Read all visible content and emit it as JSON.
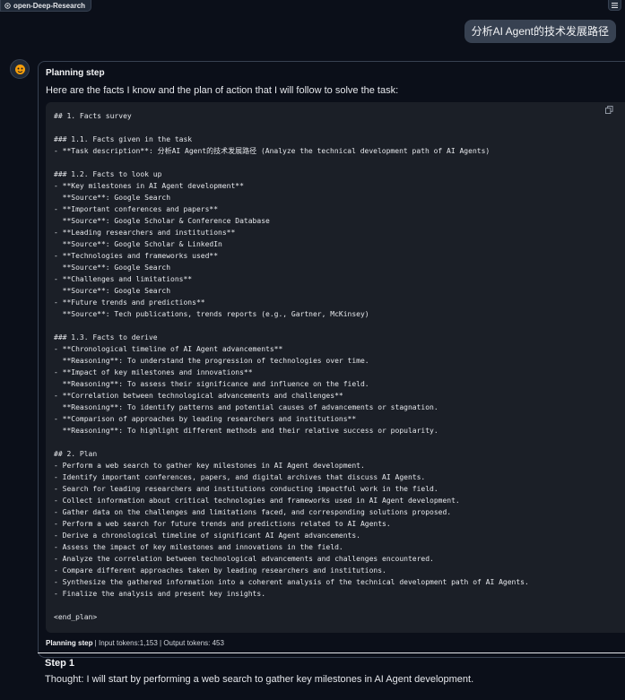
{
  "app": {
    "tab_title": "open-Deep-Research"
  },
  "user_message": {
    "text": "分析AI Agent的技术发展路径"
  },
  "planning": {
    "title": "Planning step",
    "intro": "Here are the facts I know and the plan of action that I will follow to solve the task:",
    "code_lines": [
      "## 1. Facts survey",
      "",
      "### 1.1. Facts given in the task",
      "- **Task description**: 分析AI Agent的技术发展路径 (Analyze the technical development path of AI Agents)",
      "",
      "### 1.2. Facts to look up",
      "- **Key milestones in AI Agent development**",
      "  **Source**: Google Search",
      "- **Important conferences and papers**",
      "  **Source**: Google Scholar & Conference Database",
      "- **Leading researchers and institutions**",
      "  **Source**: Google Scholar & LinkedIn",
      "- **Technologies and frameworks used**",
      "  **Source**: Google Search",
      "- **Challenges and limitations**",
      "  **Source**: Google Search",
      "- **Future trends and predictions**",
      "  **Source**: Tech publications, trends reports (e.g., Gartner, McKinsey)",
      "",
      "### 1.3. Facts to derive",
      "- **Chronological timeline of AI Agent advancements**",
      "  **Reasoning**: To understand the progression of technologies over time.",
      "- **Impact of key milestones and innovations**",
      "  **Reasoning**: To assess their significance and influence on the field.",
      "- **Correlation between technological advancements and challenges**",
      "  **Reasoning**: To identify patterns and potential causes of advancements or stagnation.",
      "- **Comparison of approaches by leading researchers and institutions**",
      "  **Reasoning**: To highlight different methods and their relative success or popularity.",
      "",
      "## 2. Plan",
      "- Perform a web search to gather key milestones in AI Agent development.",
      "- Identify important conferences, papers, and digital archives that discuss AI Agents.",
      "- Search for leading researchers and institutions conducting impactful work in the field.",
      "- Collect information about critical technologies and frameworks used in AI Agent development.",
      "- Gather data on the challenges and limitations faced, and corresponding solutions proposed.",
      "- Perform a web search for future trends and predictions related to AI Agents.",
      "- Derive a chronological timeline of significant AI Agent advancements.",
      "- Assess the impact of key milestones and innovations in the field.",
      "- Analyze the correlation between technological advancements and challenges encountered.",
      "- Compare different approaches taken by leading researchers and institutions.",
      "- Synthesize the gathered information into a coherent analysis of the technical development path of AI Agents.",
      "- Finalize the analysis and present key insights.",
      "",
      "<end_plan>"
    ],
    "footer_label": "Planning step",
    "footer_stats": " | Input tokens:1,153 | Output tokens: 453"
  },
  "step1": {
    "title": "Step 1",
    "thought": "Thought: I will start by performing a web search to gather key milestones in AI Agent development."
  },
  "icons": {
    "tab": "gradio-icon",
    "corner": "menu-icon",
    "avatar": "bot-avatar-icon",
    "copy": "copy-icon"
  },
  "colors": {
    "background": "#0b0f19",
    "code_background": "#1b1f27",
    "user_bubble": "#374151"
  }
}
